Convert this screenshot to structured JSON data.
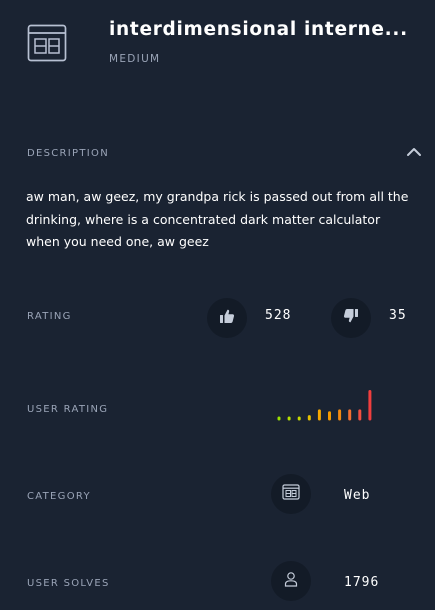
{
  "header": {
    "title": "interdimensional interne...",
    "difficulty": "MEDIUM",
    "icon": "web-window-icon"
  },
  "description": {
    "label": "DESCRIPTION",
    "text": "aw man, aw geez, my grandpa rick is passed out from all the drinking, where is a concentrated dark matter calculator when you need one, aw geez",
    "toggle_icon": "chevron-up-icon"
  },
  "rating": {
    "label": "RATING",
    "likes": "528",
    "dislikes": "35",
    "like_icon": "thumbs-up-icon",
    "dislike_icon": "thumbs-down-icon"
  },
  "user_rating": {
    "label": "USER RATING",
    "distribution": [
      1,
      1,
      1,
      2,
      5,
      4,
      5,
      5,
      5,
      15
    ],
    "colors": [
      "#9be000",
      "#b8e000",
      "#c7d800",
      "#e6c000",
      "#f5a800",
      "#f59a00",
      "#f58a10",
      "#f57030",
      "#f25040",
      "#f03e3e"
    ]
  },
  "category": {
    "label": "CATEGORY",
    "value": "Web",
    "icon": "web-window-icon"
  },
  "user_solves": {
    "label": "USER SOLVES",
    "value": "1796",
    "icon": "user-icon"
  }
}
